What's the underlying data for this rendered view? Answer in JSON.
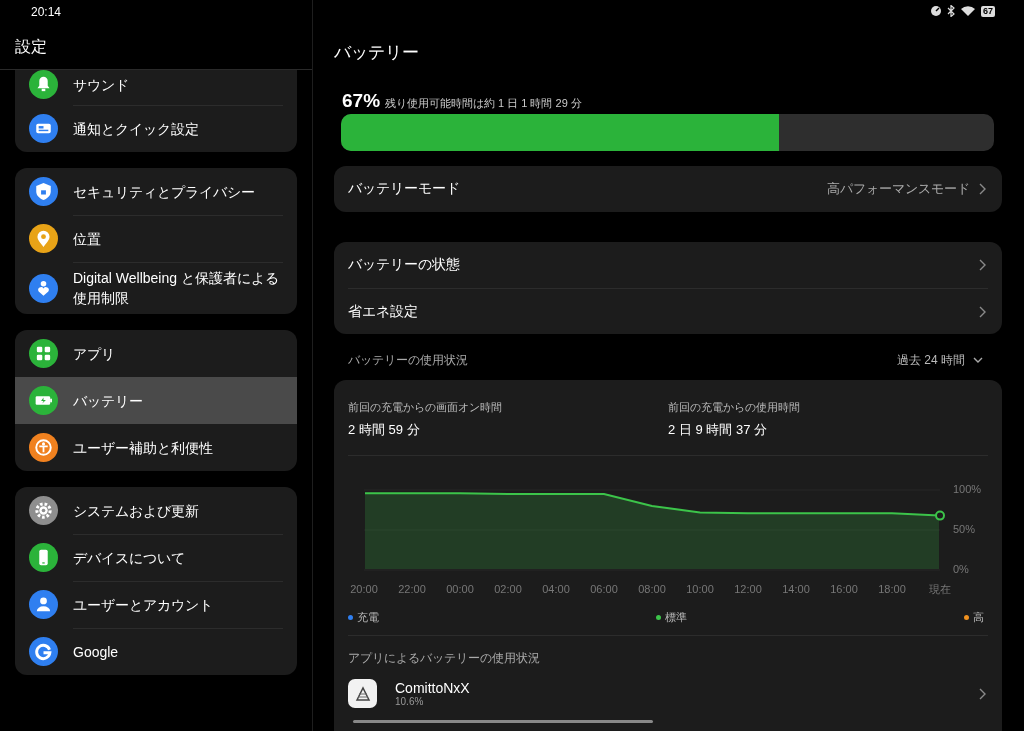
{
  "status_bar": {
    "time": "20:14",
    "battery": "67"
  },
  "sidebar": {
    "title": "設定",
    "groups": [
      {
        "items": [
          {
            "label": "サウンド",
            "color": "#2bb33a",
            "selected": false
          },
          {
            "label": "通知とクイック設定",
            "color": "#2f7ff0",
            "selected": false
          }
        ]
      },
      {
        "items": [
          {
            "label": "セキュリティとプライバシー",
            "color": "#2f7ff0",
            "selected": false
          },
          {
            "label": "位置",
            "color": "#e8a317",
            "selected": false
          },
          {
            "label": "Digital Wellbeing と保護者による使用制限",
            "color": "#2f7ff0",
            "selected": false
          }
        ]
      },
      {
        "items": [
          {
            "label": "アプリ",
            "color": "#2bb33a",
            "selected": false
          },
          {
            "label": "バッテリー",
            "color": "#2bb33a",
            "selected": true
          },
          {
            "label": "ユーザー補助と利便性",
            "color": "#f0811f",
            "selected": false
          }
        ]
      },
      {
        "items": [
          {
            "label": "システムおよび更新",
            "color": "#8e8e8e",
            "selected": false
          },
          {
            "label": "デバイスについて",
            "color": "#2bb33a",
            "selected": false
          },
          {
            "label": "ユーザーとアカウント",
            "color": "#2f7ff0",
            "selected": false
          },
          {
            "label": "Google",
            "color": "#2f7ff0",
            "selected": false
          }
        ]
      }
    ]
  },
  "main": {
    "title": "バッテリー",
    "percent": "67%",
    "remaining": "残り使用可能時間は約 1 日 1 時間 29 分",
    "battery_bar": {
      "level": 0.67
    },
    "mode_row": {
      "label": "バッテリーモード",
      "value": "高パフォーマンスモード"
    },
    "settings_rows": [
      {
        "label": "バッテリーの状態"
      },
      {
        "label": "省エネ設定"
      }
    ],
    "usage": {
      "title": "バッテリーの使用状況",
      "range": "過去 24 時間",
      "stats": [
        {
          "label": "前回の充電からの画面オン時間",
          "value": "2 時間 59 分"
        },
        {
          "label": "前回の充電からの使用時間",
          "value": "2 日 9 時間 37 分"
        }
      ],
      "chart_data": {
        "type": "area",
        "categories": [
          "20:00",
          "22:00",
          "00:00",
          "02:00",
          "04:00",
          "06:00",
          "08:00",
          "10:00",
          "12:00",
          "14:00",
          "16:00",
          "18:00",
          "現在"
        ],
        "series": [
          {
            "name": "標準",
            "color": "#3cc44a",
            "values": [
              96,
              96,
              96,
              95,
              95,
              95,
              80,
              72,
              71,
              71,
              71,
              71,
              68
            ]
          }
        ],
        "ylim": [
          0,
          100
        ],
        "yticks": [
          {
            "value": 100,
            "label": "100%"
          },
          {
            "value": 50,
            "label": "50%"
          },
          {
            "value": 0,
            "label": "0%"
          }
        ]
      },
      "legend": [
        {
          "label": "充電",
          "color": "#2f7ff0"
        },
        {
          "label": "高",
          "color": "#f0911f"
        }
      ]
    },
    "apps_title": "アプリによるバッテリーの使用状況",
    "apps": [
      {
        "name": "ComittoNxX",
        "share": "10.6%"
      }
    ]
  }
}
